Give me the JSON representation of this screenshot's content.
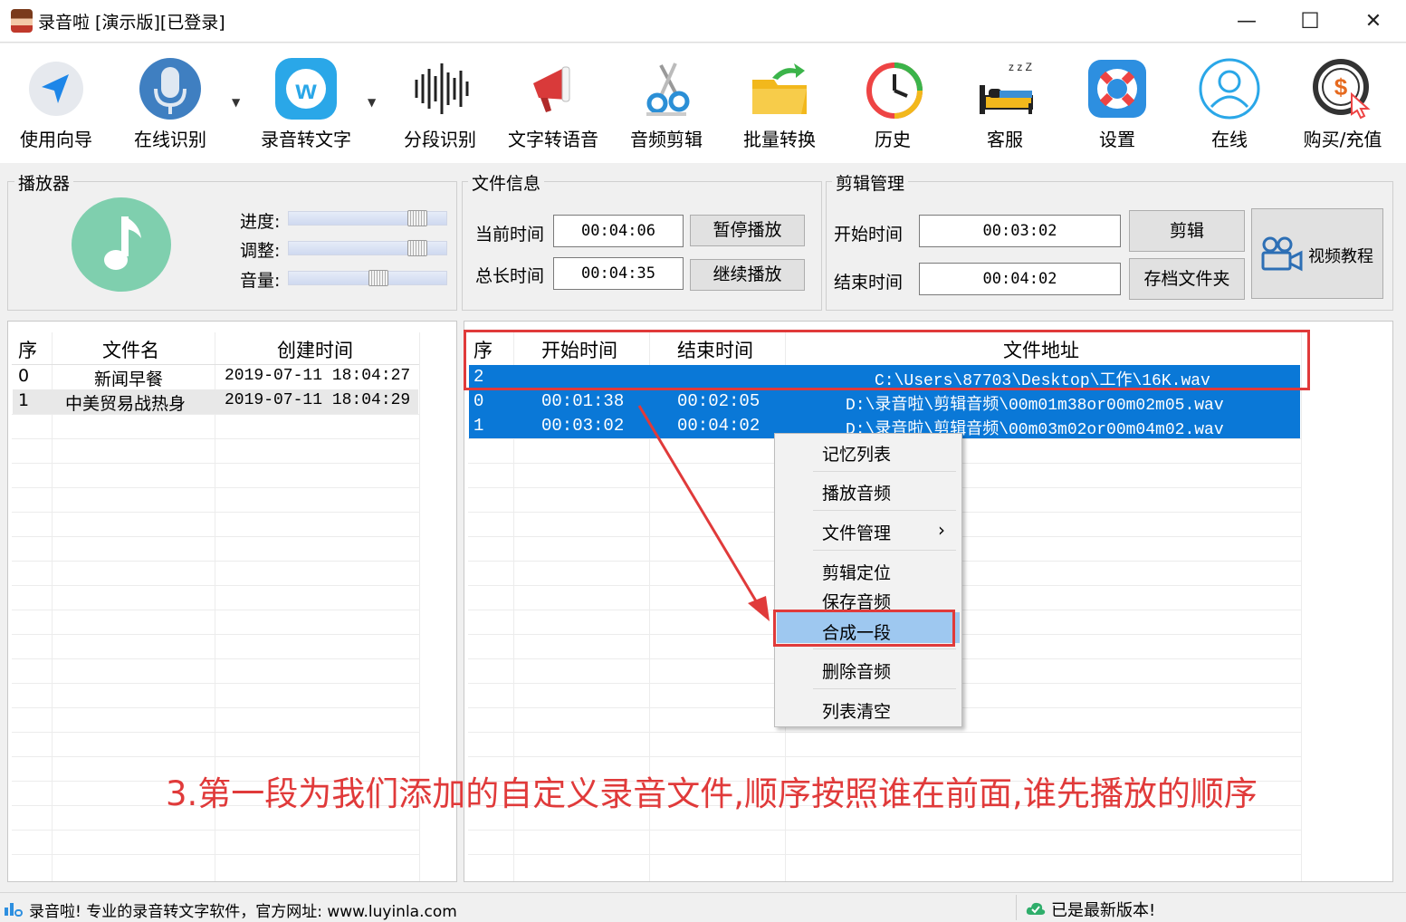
{
  "window": {
    "title": "录音啦 [演示版][已登录]",
    "minimize": "—",
    "maximize": "☐",
    "close": "✕"
  },
  "toolbar": {
    "items": [
      {
        "label": "使用向导",
        "icon": "navigate-icon"
      },
      {
        "label": "在线识别",
        "icon": "microphone-icon"
      },
      {
        "label": "录音转文字",
        "icon": "w-logo-icon"
      },
      {
        "label": "分段识别",
        "icon": "waveform-icon"
      },
      {
        "label": "文字转语音",
        "icon": "megaphone-icon"
      },
      {
        "label": "音频剪辑",
        "icon": "scissors-icon"
      },
      {
        "label": "批量转换",
        "icon": "folder-arrow-icon"
      },
      {
        "label": "历史",
        "icon": "history-clock-icon"
      },
      {
        "label": "客服",
        "icon": "sleeping-bed-icon"
      },
      {
        "label": "设置",
        "icon": "lifebuoy-icon"
      },
      {
        "label": "在线",
        "icon": "user-circle-icon"
      },
      {
        "label": "购买/充值",
        "icon": "dollar-coin-icon"
      }
    ],
    "dropdown_arrow": "▼"
  },
  "player": {
    "title": "播放器",
    "progress_label": "进度:",
    "adjust_label": "调整:",
    "volume_label": "音量:",
    "progress_value": 0.86,
    "adjust_value": 0.86,
    "volume_value": 0.58
  },
  "file_info": {
    "title": "文件信息",
    "current_time_label": "当前时间",
    "current_time": "00:04:06",
    "total_time_label": "总长时间",
    "total_time": "00:04:35",
    "pause_button": "暂停播放",
    "resume_button": "继续播放"
  },
  "clip_manager": {
    "title": "剪辑管理",
    "start_label": "开始时间",
    "start_time": "00:03:02",
    "end_label": "结束时间",
    "end_time": "00:04:02",
    "clip_button": "剪辑",
    "archive_button": "存档文件夹",
    "video_tutorial": "视频教程"
  },
  "left_table": {
    "columns": [
      "序",
      "文件名",
      "创建时间"
    ],
    "rows": [
      {
        "idx": "0",
        "name": "新闻早餐",
        "created": "2019-07-11  18:04:27"
      },
      {
        "idx": "1",
        "name": "中美贸易战热身",
        "created": "2019-07-11  18:04:29"
      }
    ]
  },
  "right_table": {
    "columns": [
      "序",
      "开始时间",
      "结束时间",
      "文件地址"
    ],
    "rows": [
      {
        "idx": "2",
        "start": "",
        "end": "",
        "path": "C:\\Users\\87703\\Desktop\\工作\\16K.wav"
      },
      {
        "idx": "0",
        "start": "00:01:38",
        "end": "00:02:05",
        "path": "D:\\录音啦\\剪辑音频\\00m01m38or00m02m05.wav"
      },
      {
        "idx": "1",
        "start": "00:03:02",
        "end": "00:04:02",
        "path": "D:\\录音啦\\剪辑音频\\00m03m02or00m04m02.wav"
      }
    ]
  },
  "context_menu": {
    "items": [
      "记忆列表",
      "播放音频",
      "文件管理",
      "剪辑定位",
      "保存音频",
      "合成一段",
      "删除音频",
      "列表清空"
    ],
    "submenu_arrow": "›",
    "highlighted": "合成一段"
  },
  "annotation": {
    "text": "3.第一段为我们添加的自定义录音文件,顺序按照谁在前面,谁先播放的顺序",
    "color": "#e03a3a"
  },
  "status": {
    "left": "录音啦! 专业的录音转文字软件，官方网址: www.luyinla.com",
    "right": "已是最新版本!"
  },
  "colors": {
    "selection": "#0a78d7",
    "annotation_red": "#e03a3a",
    "music_icon_bg": "#7fcfae"
  }
}
